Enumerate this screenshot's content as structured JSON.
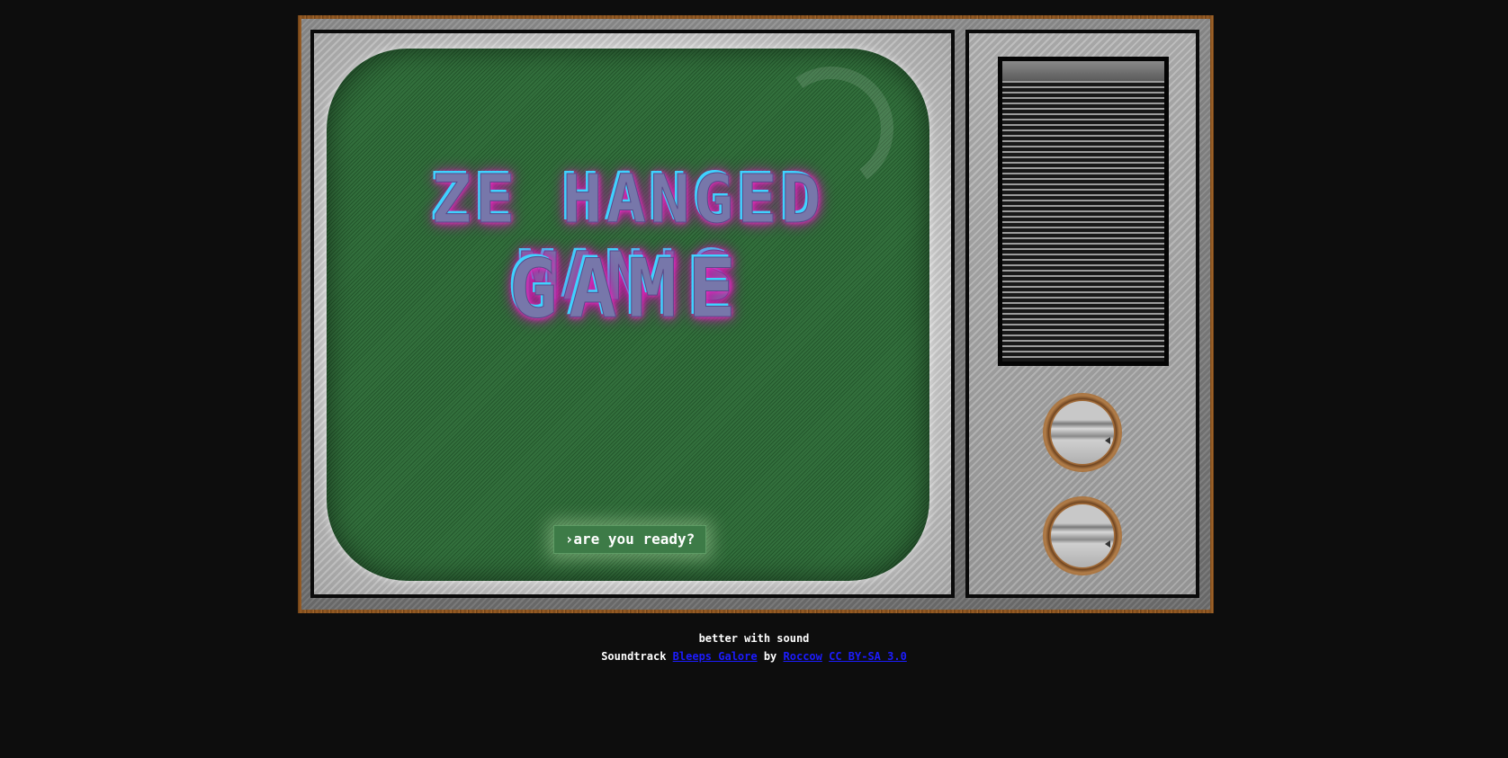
{
  "game": {
    "title_line1": "ZE HANGED MAN'S",
    "title_line2": "GAME",
    "start_prompt": "›are you ready?"
  },
  "footer": {
    "sound_note": "better with sound",
    "soundtrack_label": "Soundtrack",
    "track_name": "Bleeps Galore",
    "by_label": "by",
    "artist": "Roccow",
    "license": "CC BY-SA 3.0"
  },
  "colors": {
    "screen_green": "#2b6a35",
    "title_glow": "#ff33cc",
    "title_highlight": "#3fd2ff",
    "wood_frame": "#9a5d24",
    "link_blue": "#1c1cff"
  },
  "icons": {
    "knob_1": "knob-icon",
    "knob_2": "knob-icon",
    "speaker": "speaker-grille"
  }
}
